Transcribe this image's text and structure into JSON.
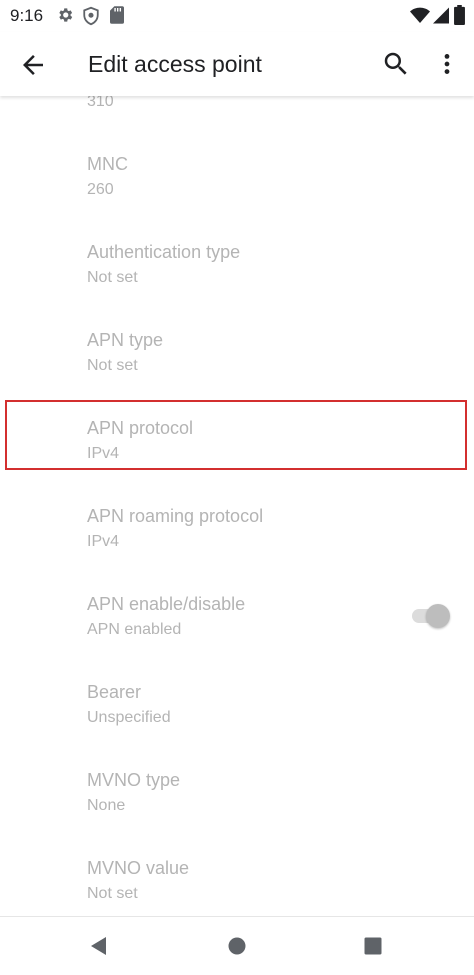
{
  "status_bar": {
    "time": "9:16",
    "icons": [
      "settings-icon",
      "shield-icon",
      "sd-card-icon",
      "wifi-icon",
      "signal-icon",
      "battery-icon"
    ]
  },
  "app_bar": {
    "title": "Edit access point",
    "icons": [
      "back-arrow-icon",
      "search-icon",
      "more-vert-icon"
    ]
  },
  "preferences": [
    {
      "title": "",
      "summary": "310"
    },
    {
      "title": "MNC",
      "summary": "260"
    },
    {
      "title": "Authentication type",
      "summary": "Not set"
    },
    {
      "title": "APN type",
      "summary": "Not set"
    },
    {
      "title": "APN protocol",
      "summary": "IPv4"
    },
    {
      "title": "APN roaming protocol",
      "summary": "IPv4"
    },
    {
      "title": "APN enable/disable",
      "summary": "APN enabled",
      "toggle_on": true
    },
    {
      "title": "Bearer",
      "summary": "Unspecified"
    },
    {
      "title": "MVNO type",
      "summary": "None"
    },
    {
      "title": "MVNO value",
      "summary": "Not set"
    }
  ],
  "colors": {
    "disabled_text": "#b4b4b4",
    "highlight_border": "#d32f2f",
    "icon": "#202124"
  },
  "nav_bar": {
    "icons": [
      "back-triangle-icon",
      "home-circle-icon",
      "recents-square-icon"
    ]
  }
}
